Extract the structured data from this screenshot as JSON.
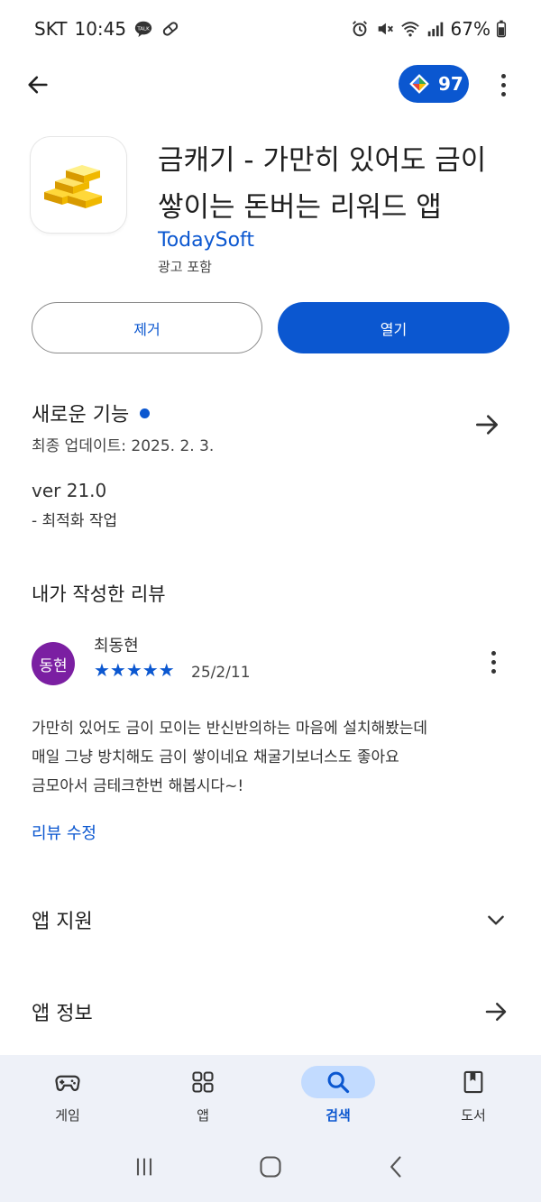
{
  "status_bar": {
    "carrier": "SKT",
    "time": "10:45",
    "battery": "67%"
  },
  "top_bar": {
    "points": "97"
  },
  "app": {
    "title": "금캐기 - 가만히 있어도 금이 쌓이는 돈버는 리워드 앱",
    "developer": "TodaySoft",
    "ads_note": "광고 포함",
    "uninstall_label": "제거",
    "open_label": "열기"
  },
  "whats_new": {
    "title": "새로운 기능",
    "updated": "최종 업데이트: 2025. 2. 3.",
    "version": "ver 21.0",
    "note": "- 최적화 작업"
  },
  "my_review": {
    "title": "내가 작성한 리뷰",
    "avatar_text": "동현",
    "reviewer": "최동현",
    "rating": 5,
    "stars": "★★★★★",
    "date": "25/2/11",
    "lines": [
      "가만히 있어도 금이 모이는 반신반의하는 마음에 설치해봤는데",
      "매일 그냥 방치해도 금이 쌓이네요 채굴기보너스도 좋아요",
      "금모아서 금테크한번 해봅시다~!"
    ],
    "edit_label": "리뷰 수정"
  },
  "sections": {
    "app_support": "앱 지원",
    "app_info": "앱 정보"
  },
  "bottom_nav": {
    "games": "게임",
    "apps": "앱",
    "search": "검색",
    "books": "도서"
  },
  "colors": {
    "accent": "#0b57d0",
    "avatar": "#7b1fa2",
    "nav_bg": "#eef1f8",
    "nav_active": "#c2dbff"
  }
}
